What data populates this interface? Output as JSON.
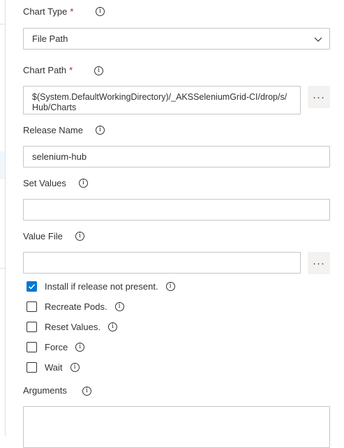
{
  "fields": {
    "chart_type": {
      "label": "Chart Type",
      "required_mark": "*",
      "value": "File Path"
    },
    "chart_path": {
      "label": "Chart Path",
      "required_mark": "*",
      "value": "$(System.DefaultWorkingDirectory)/_AKSSeleniumGrid-CI/drop/s/Hub/Charts"
    },
    "release_name": {
      "label": "Release Name",
      "value": "selenium-hub"
    },
    "set_values": {
      "label": "Set Values",
      "value": ""
    },
    "value_file": {
      "label": "Value File",
      "value": ""
    },
    "arguments": {
      "label": "Arguments",
      "value": ""
    }
  },
  "browse_label": "···",
  "info_glyph": "i",
  "checkboxes": [
    {
      "label": "Install if release not present.",
      "checked": true
    },
    {
      "label": "Recreate Pods.",
      "checked": false
    },
    {
      "label": "Reset Values.",
      "checked": false
    },
    {
      "label": "Force",
      "checked": false
    },
    {
      "label": "Wait",
      "checked": false
    }
  ],
  "colors": {
    "accent": "#0078d4",
    "required": "#a4262c",
    "border": "#c8c6c4",
    "text": "#323130"
  }
}
